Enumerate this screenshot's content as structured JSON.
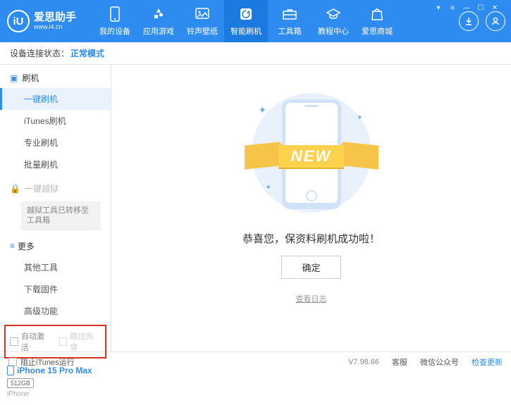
{
  "brand": {
    "logo_letter": "iU",
    "title": "爱思助手",
    "subtitle": "www.i4.cn"
  },
  "nav": {
    "items": [
      {
        "label": "我的设备"
      },
      {
        "label": "应用游戏"
      },
      {
        "label": "铃声壁纸"
      },
      {
        "label": "智能刷机"
      },
      {
        "label": "工具箱"
      },
      {
        "label": "教程中心"
      },
      {
        "label": "爱思商城"
      }
    ]
  },
  "status": {
    "label": "设备连接状态：",
    "value": "正常模式"
  },
  "sidebar": {
    "group_flash": "刷机",
    "items_flash": [
      "一键刷机",
      "iTunes刷机",
      "专业刷机",
      "批量刷机"
    ],
    "group_jailbreak": "一键越狱",
    "jailbreak_note": "越狱工具已转移至工具箱",
    "group_more": "更多",
    "items_more": [
      "其他工具",
      "下载固件",
      "高级功能"
    ],
    "auto_activate": "自动激活",
    "skip_guide": "跳过向导"
  },
  "device": {
    "name": "iPhone 15 Pro Max",
    "storage": "512GB",
    "type": "iPhone"
  },
  "main": {
    "ribbon": "NEW",
    "message": "恭喜您，保资料刷机成功啦！",
    "ok": "确定",
    "view_log": "查看日志"
  },
  "footer": {
    "block_itunes": "阻止iTunes运行",
    "version": "V7.98.66",
    "links": [
      "客服",
      "微信公众号",
      "检查更新"
    ]
  }
}
